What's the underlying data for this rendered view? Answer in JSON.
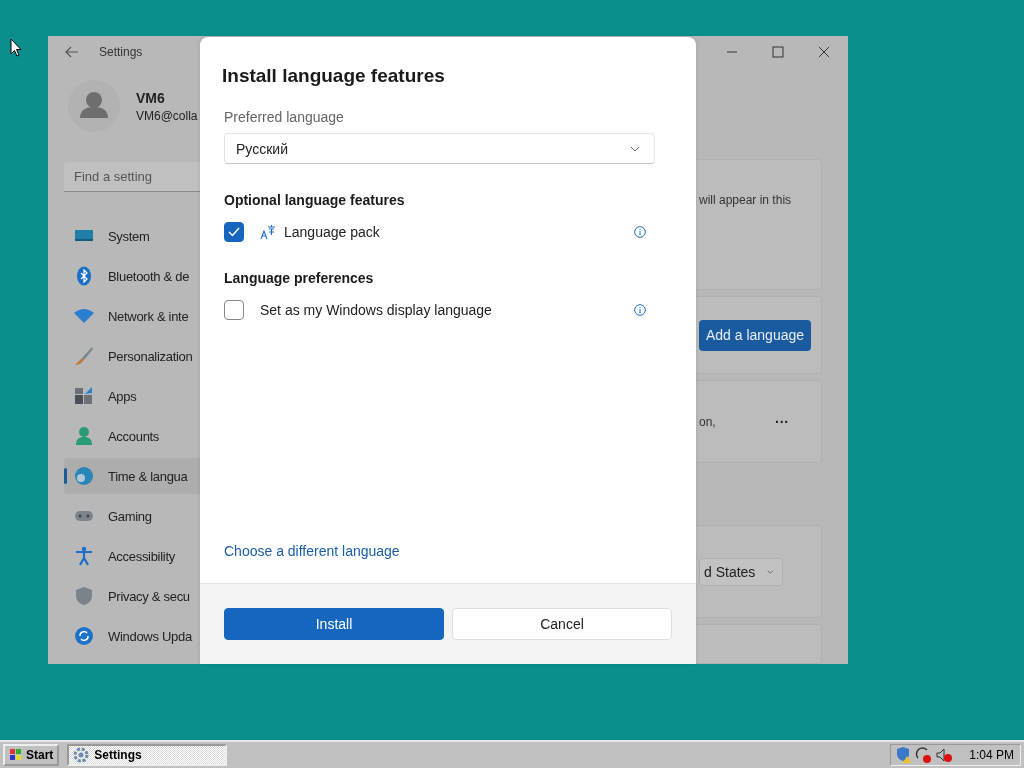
{
  "settings_window": {
    "title": "Settings",
    "user": {
      "name": "VM6",
      "email": "VM6@colla"
    },
    "search": {
      "placeholder": "Find a setting"
    },
    "nav": [
      {
        "label": "System",
        "selected": false
      },
      {
        "label": "Bluetooth & de",
        "selected": false
      },
      {
        "label": "Network & inte",
        "selected": false
      },
      {
        "label": "Personalization",
        "selected": false
      },
      {
        "label": "Apps",
        "selected": false
      },
      {
        "label": "Accounts",
        "selected": false
      },
      {
        "label": "Time & langua",
        "selected": true
      },
      {
        "label": "Gaming",
        "selected": false
      },
      {
        "label": "Accessibility",
        "selected": false
      },
      {
        "label": "Privacy & secu",
        "selected": false
      },
      {
        "label": "Windows Upda",
        "selected": false
      }
    ],
    "content": {
      "card_text": "will appear in this",
      "add_button": "Add a language",
      "row_text": "on,",
      "more_button": "···",
      "region_dropdown": "d States"
    }
  },
  "dialog": {
    "title": "Install language features",
    "preferred_language": {
      "label": "Preferred language",
      "value": "Русский"
    },
    "sections": [
      {
        "heading": "Optional language features",
        "options": [
          {
            "label": "Language pack",
            "checked": true,
            "kind": "feature"
          }
        ]
      },
      {
        "heading": "Language preferences",
        "options": [
          {
            "label": "Set as my Windows display language",
            "checked": false,
            "kind": "preference"
          }
        ]
      }
    ],
    "link": "Choose a different language",
    "buttons": [
      {
        "label": "Install",
        "kind": "primary"
      },
      {
        "label": "Cancel",
        "kind": "secondary"
      }
    ]
  },
  "taskbar": {
    "start": "Start",
    "tasks": [
      {
        "label": "Settings",
        "selected": true
      }
    ],
    "clock": "1:04 PM"
  }
}
